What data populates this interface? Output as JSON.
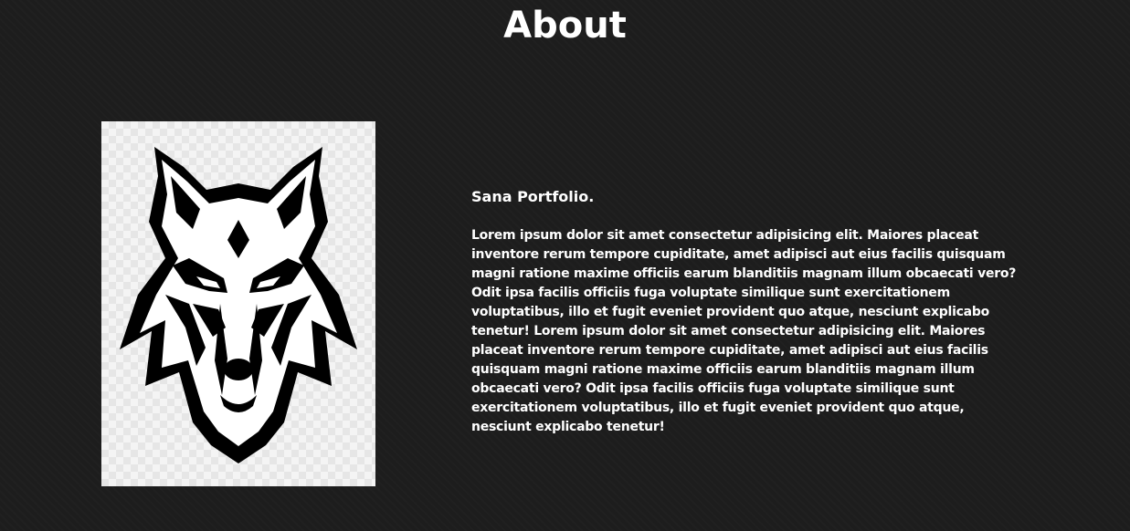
{
  "header": {
    "title": "About"
  },
  "about": {
    "image_icon": "wolf-head-logo",
    "name": "Sana Portfolio.",
    "paragraph": "Lorem ipsum dolor sit amet consectetur adipisicing elit. Maiores placeat inventore rerum tempore cupiditate, amet adipisci aut eius facilis quisquam magni ratione maxime officiis earum blanditiis magnam illum obcaecati vero? Odit ipsa facilis officiis fuga voluptate similique sunt exercitationem voluptatibus, illo et fugit eveniet provident quo atque, nesciunt explicabo tenetur! Lorem ipsum dolor sit amet consectetur adipisicing elit. Maiores placeat inventore rerum tempore cupiditate, amet adipisci aut eius facilis quisquam magni ratione maxime officiis earum blanditiis magnam illum obcaecati vero? Odit ipsa facilis officiis fuga voluptate similique sunt exercitationem voluptatibus, illo et fugit eveniet provident quo atque, nesciunt explicabo tenetur!"
  },
  "colors": {
    "background": "#1d1d1d",
    "text": "#ffffff"
  }
}
